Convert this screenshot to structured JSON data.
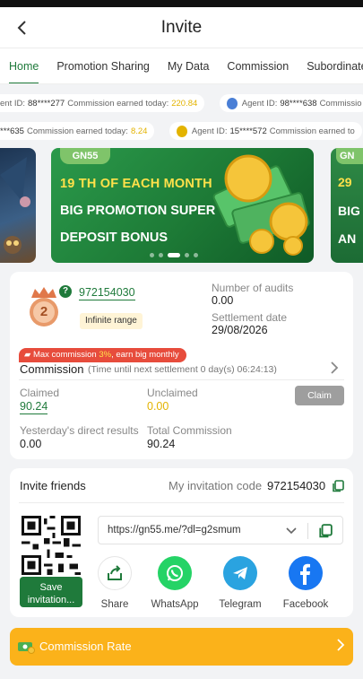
{
  "header": {
    "title": "Invite",
    "back_glyph": "‹"
  },
  "tabs": [
    "Home",
    "Promotion Sharing",
    "My Data",
    "Commission",
    "Subordinate"
  ],
  "ticker_row1": [
    {
      "prefix": "ent ID:",
      "agent": "88****277",
      "label": "Commission earned today:",
      "amount": "220.84"
    },
    {
      "prefix": "Agent ID:",
      "agent": "98****638",
      "label": "Commissio",
      "amount": ""
    }
  ],
  "ticker_row2": [
    {
      "prefix": "",
      "agent": "***635",
      "label": "Commission earned today:",
      "amount": "8.24"
    },
    {
      "prefix": "Agent ID:",
      "agent": "15****572",
      "label": "Commission earned to",
      "amount": ""
    }
  ],
  "banner": {
    "brand": "GN55",
    "line1": "19 TH OF EACH MONTH",
    "line2": "BIG PROMOTION SUPER",
    "line3": "DEPOSIT BONUS",
    "right_brand": "GN",
    "right_line1": "29",
    "right_line2": "BIG",
    "right_line3": "AN"
  },
  "agent": {
    "level": "2",
    "uid": "972154030",
    "range": "Infinite range",
    "audits_label": "Number of audits",
    "audits_value": "0.00",
    "settlement_label": "Settlement date",
    "settlement_value": "29/08/2026"
  },
  "commission": {
    "tag_before": "Max commission ",
    "tag_highlight": "3%",
    "tag_after": ", earn big monthly",
    "title": "Commission",
    "subtitle": "(Time until next settlement  0 day(s) 06:24:13)",
    "claimed_label": "Claimed",
    "claimed_value": "90.24",
    "unclaimed_label": "Unclaimed",
    "unclaimed_value": "0.00",
    "claim_button": "Claim",
    "yesterday_label": "Yesterday's direct results",
    "yesterday_value": "0.00",
    "total_label": "Total Commission",
    "total_value": "90.24"
  },
  "invite": {
    "title": "Invite friends",
    "code_label": "My invitation code",
    "code_value": "972154030",
    "save_button_line1": "Save",
    "save_button_line2": "invitation...",
    "link": "https://gn55.me/?dl=g2smum",
    "share": [
      {
        "label": "Share",
        "icon": "share-icon"
      },
      {
        "label": "WhatsApp",
        "icon": "whatsapp-icon"
      },
      {
        "label": "Telegram",
        "icon": "telegram-icon"
      },
      {
        "label": "Facebook",
        "icon": "facebook-icon"
      }
    ]
  },
  "rate_bar": {
    "label": "Commission Rate"
  },
  "colors": {
    "brand_green": "#1f7a3b",
    "gold": "#e3b300",
    "orange": "#fbb21a",
    "red_tag": "#e74c3c"
  }
}
